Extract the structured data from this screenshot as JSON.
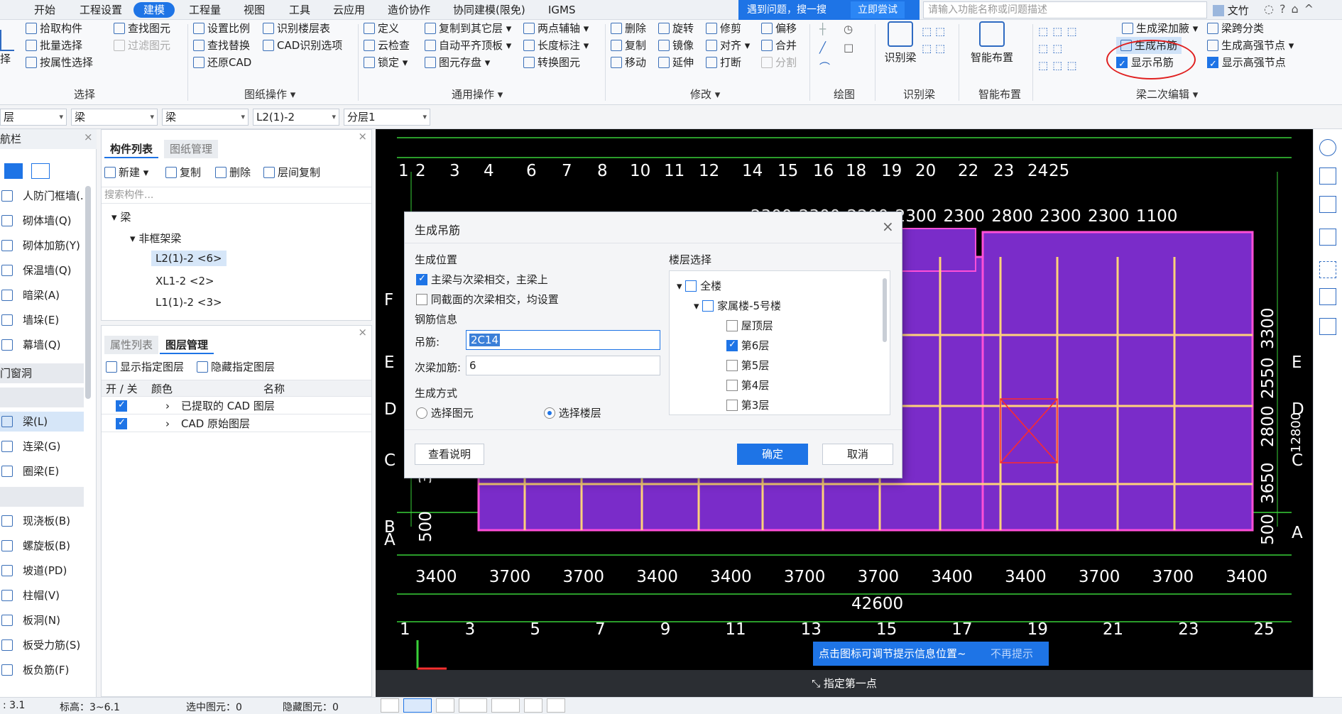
{
  "menu": {
    "items": [
      "开始",
      "工程设置",
      "建模",
      "工程量",
      "视图",
      "工具",
      "云应用",
      "造价协作",
      "协同建模(限免)",
      "IGMS"
    ],
    "hint_text": "遇到问题，搜一搜",
    "hint_button": "立即尝试",
    "search_placeholder": "请输入功能名称或问题描述",
    "user": "文竹"
  },
  "ribbon": {
    "select_group": {
      "items": [
        "拾取构件",
        "批量选择",
        "按属性选择",
        "查找图元",
        "过滤图元"
      ],
      "label": "选择",
      "big_fragment": "择"
    },
    "drawing_ops": {
      "items": [
        "设置比例",
        "查找替换",
        "还原CAD",
        "识别楼层表",
        "CAD识别选项"
      ],
      "label": "图纸操作"
    },
    "general_ops": {
      "items": [
        "定义",
        "云检查",
        "锁定",
        "复制到其它层",
        "自动平齐顶板",
        "图元存盘",
        "两点辅轴",
        "长度标注",
        "转换图元"
      ],
      "label": "通用操作"
    },
    "modify": {
      "items": [
        "删除",
        "旋转",
        "修剪",
        "偏移",
        "复制",
        "镜像",
        "对齐",
        "合并",
        "移动",
        "延伸",
        "打断",
        "分割"
      ],
      "label": "修改"
    },
    "draw": {
      "label": "绘图"
    },
    "recognize_beam": {
      "button": "识别梁",
      "label": "识别梁"
    },
    "smart_layout": {
      "button": "智能布置",
      "label": "智能布置"
    },
    "beam_edit": {
      "items": [
        "生成梁加腋",
        "生成吊筋",
        "显示吊筋",
        "梁跨分类",
        "生成高强节点",
        "显示高强节点"
      ],
      "label": "梁二次编辑"
    }
  },
  "selectors": [
    "层",
    "梁",
    "梁",
    "L2(1)-2",
    "分层1"
  ],
  "leftnav": {
    "title": "航栏",
    "items": [
      "人防门框墙(.",
      "砌体墙(Q)",
      "砌体加筋(Y)",
      "保温墙(Q)",
      "暗梁(A)",
      "墙垛(E)",
      "幕墙(Q)",
      "梁(L)",
      "连梁(G)",
      "圈梁(E)",
      "现浇板(B)",
      "螺旋板(B)",
      "坡道(PD)",
      "柱帽(V)",
      "板洞(N)",
      "板受力筋(S)",
      "板负筋(F)"
    ],
    "section_door": "门窗洞"
  },
  "component_panel": {
    "tabs": [
      "构件列表",
      "图纸管理"
    ],
    "actions": [
      "新建",
      "复制",
      "删除",
      "层间复制"
    ],
    "search_placeholder": "搜索构件...",
    "tree": {
      "root": "梁",
      "group": "非框架梁",
      "items": [
        "L2(1)-2 <6>",
        "XL1-2 <2>",
        "L1(1)-2 <3>"
      ]
    }
  },
  "layer_panel": {
    "tabs": [
      "属性列表",
      "图层管理"
    ],
    "actions": [
      "显示指定图层",
      "隐藏指定图层"
    ],
    "headers": [
      "开 / 关",
      "颜色",
      "名称"
    ],
    "rows": [
      "已提取的 CAD 图层",
      "CAD 原始图层"
    ]
  },
  "canvas": {
    "top_axes": [
      "1",
      "2",
      "3",
      "4",
      "6",
      "7",
      "8",
      "10",
      "11",
      "12",
      "14",
      "15",
      "16",
      "18",
      "19",
      "20",
      "22",
      "23",
      "24",
      "25"
    ],
    "bottom_axes": [
      "1",
      "3",
      "5",
      "7",
      "9",
      "11",
      "13",
      "15",
      "17",
      "19",
      "21",
      "23",
      "25"
    ],
    "top_dims": [
      "2300",
      "2300",
      "2200",
      "2300",
      "2300",
      "2800",
      "2300",
      "2300",
      "1100"
    ],
    "bottom_dims": [
      "3400",
      "3700",
      "3700",
      "3400",
      "3400",
      "3700",
      "3700",
      "3400",
      "3400",
      "3700",
      "3700",
      "3400"
    ],
    "total_dim": "42600",
    "left_side_dims": [
      "3650",
      "500"
    ],
    "right_side_dims": [
      "3300",
      "2550",
      "12800",
      "2800",
      "3650",
      "500"
    ],
    "row_labels_left": [
      "F",
      "E",
      "D",
      "C",
      "B",
      "A"
    ],
    "row_labels_right": [
      "E",
      "D",
      "C",
      "A"
    ],
    "tooltip": "点击图标可调节提示信息位置~",
    "tooltip_dismiss": "不再提示",
    "prompt": "指定第一点"
  },
  "dialog": {
    "title": "生成吊筋",
    "position_section": "生成位置",
    "opt1": "主梁与次梁相交，主梁上",
    "opt2": "同截面的次梁相交，均设置",
    "rebar_section": "钢筋信息",
    "hanger_label": "吊筋:",
    "hanger_value": "2C14",
    "stirrup_label": "次梁加筋:",
    "stirrup_value": "6",
    "method_section": "生成方式",
    "method1": "选择图元",
    "method2": "选择楼层",
    "floor_section": "楼层选择",
    "floors": {
      "all": "全楼",
      "building": "家属楼-5号楼",
      "levels": [
        "屋顶层",
        "第6层",
        "第5层",
        "第4层",
        "第3层"
      ]
    },
    "help_button": "查看说明",
    "ok_button": "确定",
    "cancel_button": "取消"
  },
  "status": {
    "coord": ": 3.1",
    "elevation": "标高：3~6.1",
    "selected": "选中图元：0",
    "hidden": "隐藏图元：0"
  }
}
